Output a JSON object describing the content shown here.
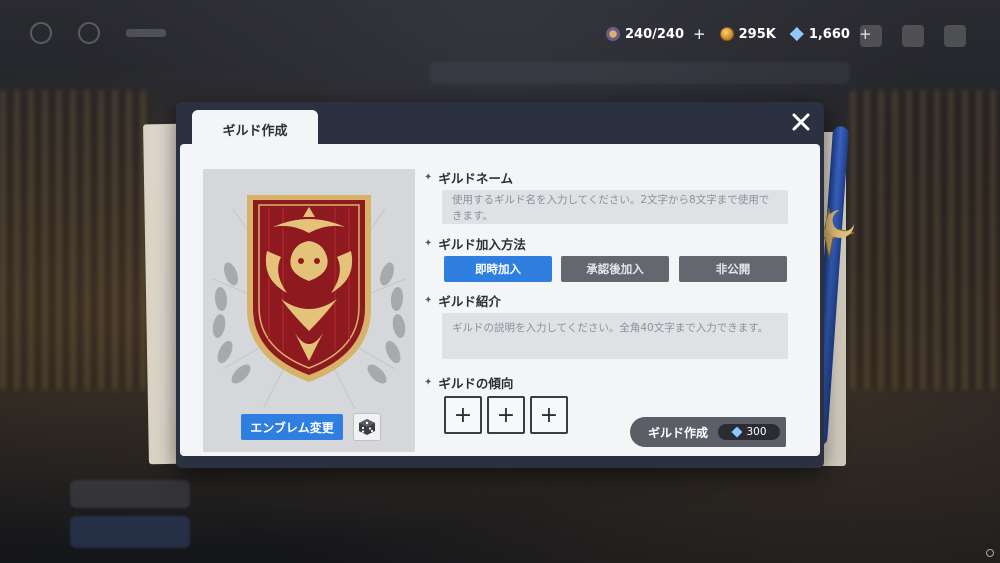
{
  "resources": {
    "stamina": "240/240",
    "gold": "295K",
    "gems": "1,660",
    "stamina_icon": "stamina-icon",
    "gold_icon": "coin-icon",
    "gem_icon": "gem-icon",
    "plus_symbol": "+"
  },
  "modal": {
    "tab_title": "ギルド作成",
    "close_icon": "close-icon"
  },
  "emblem": {
    "change_label": "エンブレム変更",
    "random_icon": "dice-icon"
  },
  "form": {
    "name_label": "ギルドネーム",
    "name_placeholder": "使用するギルド名を入力してください。2文字から8文字まで使用できます。",
    "join_label": "ギルド加入方法",
    "join_options": [
      "即時加入",
      "承認後加入",
      "非公開"
    ],
    "join_selected": "即時加入",
    "intro_label": "ギルド紹介",
    "intro_placeholder": "ギルドの説明を入力してください。全角40文字まで入力できます。",
    "tendency_label": "ギルドの傾向",
    "tendency_slot_symbol": "+",
    "bullet": "✦"
  },
  "create": {
    "label": "ギルド作成",
    "cost": "300"
  },
  "colors": {
    "accent_blue": "#2f7fe0",
    "button_gray": "#64676e",
    "emblem_red": "#8e1a1f",
    "emblem_gold": "#d7b36a"
  }
}
